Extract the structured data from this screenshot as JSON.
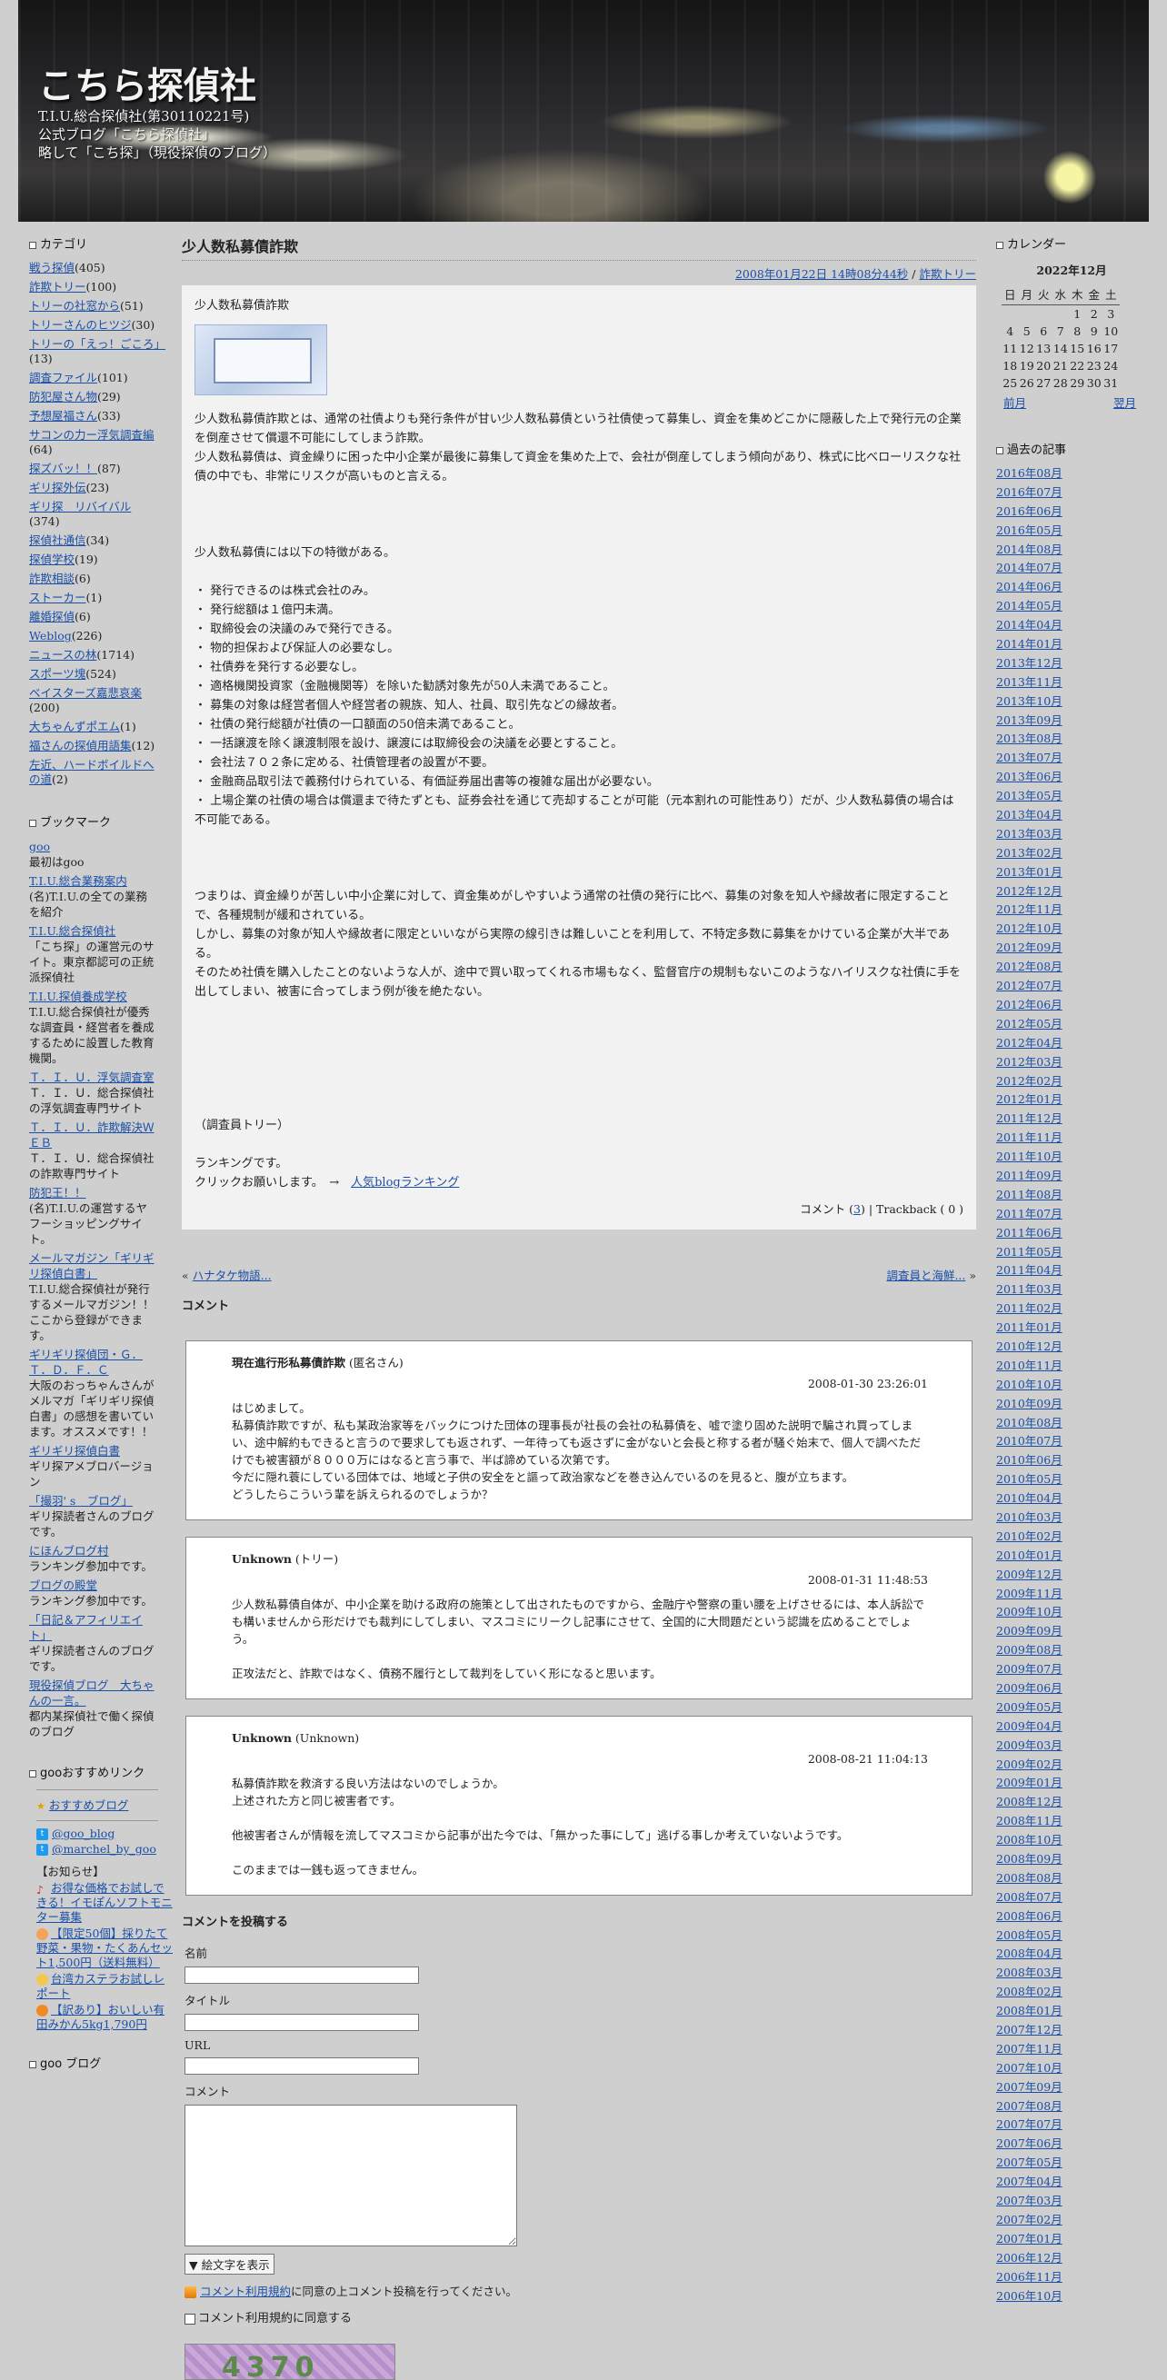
{
  "site": {
    "title": "こちら探偵社",
    "desc_lines": [
      "T.I.U.総合探偵社(第30110221号)",
      "公式ブログ「こちら探偵社」",
      "略して「こち探」（現役探偵のブログ）"
    ]
  },
  "left": {
    "categories_heading": "カテゴリ",
    "categories": [
      {
        "name": "戦う探偵",
        "count": "(405)"
      },
      {
        "name": "詐欺トリー",
        "count": "(100)"
      },
      {
        "name": "トリーの社窓から",
        "count": "(51)"
      },
      {
        "name": "トリーさんのヒツジ",
        "count": "(30)"
      },
      {
        "name": "トリーの「えっ！ごころ」",
        "count": "(13)"
      },
      {
        "name": "調査ファイル",
        "count": "(101)"
      },
      {
        "name": "防犯屋さん物",
        "count": "(29)"
      },
      {
        "name": "予想屋福さん",
        "count": "(33)"
      },
      {
        "name": "サコンの力ー浮気調査編",
        "count": "(64)"
      },
      {
        "name": "探ズバッ！！",
        "count": "(87)"
      },
      {
        "name": "ギリ探外伝",
        "count": "(23)"
      },
      {
        "name": "ギリ探　リバイバル",
        "count": "(374)"
      },
      {
        "name": "探偵社通信",
        "count": "(34)"
      },
      {
        "name": "探偵学校",
        "count": "(19)"
      },
      {
        "name": "詐欺相談",
        "count": "(6)"
      },
      {
        "name": "ストーカー",
        "count": "(1)"
      },
      {
        "name": "離婚探偵",
        "count": "(6)"
      },
      {
        "name": "Weblog",
        "count": "(226)"
      },
      {
        "name": "ニュースの林",
        "count": "(1714)"
      },
      {
        "name": "スポーツ塊",
        "count": "(524)"
      },
      {
        "name": "ベイスターズ嘉悲哀楽",
        "count": "(200)"
      },
      {
        "name": "大ちゃんずポエム",
        "count": "(1)"
      },
      {
        "name": "福さんの探偵用語集",
        "count": "(12)"
      },
      {
        "name": "左近、ハードボイルドへの道",
        "count": "(2)"
      }
    ],
    "bookmarks_heading": "ブックマーク",
    "bookmarks": [
      {
        "name": "goo",
        "desc": "最初はgoo"
      },
      {
        "name": "T.I.U.総合業務案内",
        "desc": "(名)T.I.U.の全ての業務を紹介"
      },
      {
        "name": "T.I.U.総合探偵社",
        "desc": "「こち探」の運営元のサイト。東京都認可の正統派探偵社"
      },
      {
        "name": "T.I.U.探偵養成学校",
        "desc": "T.I.U.総合探偵社が優秀な調査員・経営者を養成するために設置した教育機関。"
      },
      {
        "name": "Ｔ．Ｉ．Ｕ．浮気調査室",
        "desc": "Ｔ．Ｉ．Ｕ．総合探偵社の浮気調査専門サイト"
      },
      {
        "name": "Ｔ．Ｉ．Ｕ．詐欺解決ＷＥＢ",
        "desc": "Ｔ．Ｉ．Ｕ．総合探偵社の詐欺専門サイト"
      },
      {
        "name": "防犯王！！",
        "desc": "(名)T.I.U.の運営するヤフーショッピングサイト。"
      },
      {
        "name": "メールマガジン「ギリギリ探偵白書」",
        "desc": "T.I.U.総合探偵社が発行するメールマガジン！！ここから登録ができます。"
      },
      {
        "name": "ギリギリ探偵団・Ｇ．Ｔ．Ｄ．Ｆ．Ｃ",
        "desc": "大阪のおっちゃんさんがメルマガ「ギリギリ探偵白書」の感想を書いています。オススメです！！"
      },
      {
        "name": "ギリギリ探偵白書",
        "desc": "ギリ探アメブロバージョン"
      },
      {
        "name": "「撮羽' s　ブログ」",
        "desc": "ギリ探読者さんのブログです。"
      },
      {
        "name": "にほんブログ村",
        "desc": "ランキング参加中です。"
      },
      {
        "name": "ブログの殿堂",
        "desc": "ランキング参加中です。"
      },
      {
        "name": "「日記＆アフィリエイト」",
        "desc": "ギリ探読者さんのブログです。"
      },
      {
        "name": "現役探偵ブログ　大ちゃんの一言。",
        "desc": "都内某探偵社で働く探偵のブログ"
      }
    ],
    "recommend_heading": "gooおすすめリンク",
    "recommend_blog": "おすすめブログ",
    "twitter_links": [
      "@goo_blog",
      "@marchel_by_goo"
    ],
    "notice_heading": "【お知らせ】",
    "notices": [
      "お得な価格でお試しできる！イモぽんソフトモニター募集",
      "【限定50個】採りたて野菜・果物・たくあんセット1,500円（送料無料）",
      "台湾カステラお試しレポート",
      "【訳あり】おいしい有田みかん5kg1,790円"
    ],
    "goo_blog_heading": "goo ブログ"
  },
  "entry": {
    "title": "少人数私募債詐欺",
    "meta_date": "2008年01月22日 14時08分44秒",
    "meta_cat": "詐欺トリー",
    "p_intro": "少人数私募債詐欺",
    "p1": "少人数私募債詐欺とは、通常の社債よりも発行条件が甘い少人数私募債という社債使って募集し、資金を集めどこかに隠蔽した上で発行元の企業を倒産させて償還不可能にしてしまう詐欺。",
    "p2": "少人数私募債は、資金繰りに困った中小企業が最後に募集して資金を集めた上で、会社が倒産してしまう傾向があり、株式に比べローリスクな社債の中でも、非常にリスクが高いものと言える。",
    "p3": "少人数私募債には以下の特徴がある。",
    "features": [
      "・ 発行できるのは株式会社のみ。",
      "・ 発行総額は１億円未満。",
      "・ 取締役会の決議のみで発行できる。",
      "・ 物的担保および保証人の必要なし。",
      "・ 社債券を発行する必要なし。",
      "・ 適格機関投資家（金融機関等）を除いた勧誘対象先が50人未満であること。",
      "・ 募集の対象は経営者個人や経営者の親族、知人、社員、取引先などの縁故者。",
      "・ 社債の発行総額が社債の一口額面の50倍未満であること。",
      "・ 一括譲渡を除く譲渡制限を設け、譲渡には取締役会の決議を必要とすること。",
      "・ 会社法７０２条に定める、社債管理者の設置が不要。",
      "・ 金融商品取引法で義務付けられている、有価証券届出書等の複雑な届出が必要ない。",
      "・ 上場企業の社債の場合は償還まで待たずとも、証券会社を通じて売却することが可能（元本割れの可能性あり）だが、少人数私募債の場合は不可能である。"
    ],
    "p4": "つまりは、資金繰りが苦しい中小企業に対して、資金集めがしやすいよう通常の社債の発行に比べ、募集の対象を知人や縁故者に限定することで、各種規制が緩和されている。",
    "p5": "しかし、募集の対象が知人や縁故者に限定といいながら実際の線引きは難しいことを利用して、不特定多数に募集をかけている企業が大半である。",
    "p6": "そのため社債を購入したことのないような人が、途中で買い取ってくれる市場もなく、監督官庁の規制もないこのようなハイリスクな社債に手を出してしまい、被害に合ってしまう例が後を絶たない。",
    "sign": "（調査員トリー）",
    "rank1": "ランキングです。",
    "rank2_prefix": "クリックお願いします。　→　",
    "rank_link": "人気blogランキング",
    "foot_comment_prefix": "コメント (",
    "foot_comment_count": "3",
    "foot_comment_suffix": ") | Trackback ( 0 )"
  },
  "pager": {
    "prev": "ハナタケ物語...",
    "next": "調査員と海鮮..."
  },
  "comments_heading": "コメント",
  "comments": [
    {
      "title": "現在進行形私募債詐欺",
      "author": "(匿名さん)",
      "date": "2008-01-30 23:26:01",
      "lines": [
        "はじめまして。",
        "私募債詐欺ですが、私も某政治家等をバックにつけた団体の理事長が社長の会社の私募債を、嘘で塗り固めた説明で騙され買ってしまい、途中解約もできると言うので要求しても返されず、一年待っても返さずに金がないと会長と称する者が騒ぐ始末で、個人で調べただけでも被害額が８０００万にはなると言う事で、半ば諦めている次第です。",
        "今だに隠れ蓑にしている団体では、地域と子供の安全をと謳って政治家などを巻き込んでいるのを見ると、腹が立ちます。",
        "どうしたらこういう輩を訴えられるのでしょうか？"
      ]
    },
    {
      "title": "Unknown",
      "author": "(トリー)",
      "date": "2008-01-31 11:48:53",
      "lines": [
        "少人数私募債自体が、中小企業を助ける政府の施策として出されたものですから、金融庁や警察の重い腰を上げさせるには、本人訴訟でも構いませんから形だけでも裁判にしてしまい、マスコミにリークし記事にさせて、全国的に大問題だという認識を広めることでしょう。",
        "",
        "正攻法だと、詐欺ではなく、債務不履行として裁判をしていく形になると思います。"
      ]
    },
    {
      "title": "Unknown",
      "author": "(Unknown)",
      "date": "2008-08-21 11:04:13",
      "lines": [
        "私募債詐欺を救済する良い方法はないのでしょうか。",
        "上述された方と同じ被害者です。",
        "",
        "他被害者さんが情報を流してマスコミから記事が出た今では、「無かった事にして」逃げる事しか考えていないようです。",
        "",
        "このままでは一銭も返ってきません。"
      ]
    }
  ],
  "form": {
    "heading": "コメントを投稿する",
    "name_label": "名前",
    "title_label": "タイトル",
    "url_label": "URL",
    "comment_label": "コメント",
    "emoji_select": "▼ 絵文字を表示",
    "terms_link": "コメント利用規約",
    "terms_suffix": "に同意の上コメント投稿を行ってください。",
    "agree_label": "コメント利用規約に同意する",
    "captcha_text": "4370"
  },
  "right": {
    "calendar_heading": "カレンダー",
    "calendar_month": "2022年12月",
    "weekdays": [
      "日",
      "月",
      "火",
      "水",
      "木",
      "金",
      "土"
    ],
    "weeks": [
      [
        "",
        "",
        "",
        "",
        "1",
        "2",
        "3"
      ],
      [
        "4",
        "5",
        "6",
        "7",
        "8",
        "9",
        "10"
      ],
      [
        "11",
        "12",
        "13",
        "14",
        "15",
        "16",
        "17"
      ],
      [
        "18",
        "19",
        "20",
        "21",
        "22",
        "23",
        "24"
      ],
      [
        "25",
        "26",
        "27",
        "28",
        "29",
        "30",
        "31"
      ]
    ],
    "prev_month": "前月",
    "next_month": "翌月",
    "archive_heading": "過去の記事",
    "archives": [
      "2016年08月",
      "2016年07月",
      "2016年06月",
      "2016年05月",
      "2014年08月",
      "2014年07月",
      "2014年06月",
      "2014年05月",
      "2014年04月",
      "2014年01月",
      "2013年12月",
      "2013年11月",
      "2013年10月",
      "2013年09月",
      "2013年08月",
      "2013年07月",
      "2013年06月",
      "2013年05月",
      "2013年04月",
      "2013年03月",
      "2013年02月",
      "2013年01月",
      "2012年12月",
      "2012年11月",
      "2012年10月",
      "2012年09月",
      "2012年08月",
      "2012年07月",
      "2012年06月",
      "2012年05月",
      "2012年04月",
      "2012年03月",
      "2012年02月",
      "2012年01月",
      "2011年12月",
      "2011年11月",
      "2011年10月",
      "2011年09月",
      "2011年08月",
      "2011年07月",
      "2011年06月",
      "2011年05月",
      "2011年04月",
      "2011年03月",
      "2011年02月",
      "2011年01月",
      "2010年12月",
      "2010年11月",
      "2010年10月",
      "2010年09月",
      "2010年08月",
      "2010年07月",
      "2010年06月",
      "2010年05月",
      "2010年04月",
      "2010年03月",
      "2010年02月",
      "2010年01月",
      "2009年12月",
      "2009年11月",
      "2009年10月",
      "2009年09月",
      "2009年08月",
      "2009年07月",
      "2009年06月",
      "2009年05月",
      "2009年04月",
      "2009年03月",
      "2009年02月",
      "2009年01月",
      "2008年12月",
      "2008年11月",
      "2008年10月",
      "2008年09月",
      "2008年08月",
      "2008年07月",
      "2008年06月",
      "2008年05月",
      "2008年04月",
      "2008年03月",
      "2008年02月",
      "2008年01月",
      "2007年12月",
      "2007年11月",
      "2007年10月",
      "2007年09月",
      "2007年08月",
      "2007年07月",
      "2007年06月",
      "2007年05月",
      "2007年04月",
      "2007年03月",
      "2007年02月",
      "2007年01月",
      "2006年12月",
      "2006年11月",
      "2006年10月"
    ]
  }
}
